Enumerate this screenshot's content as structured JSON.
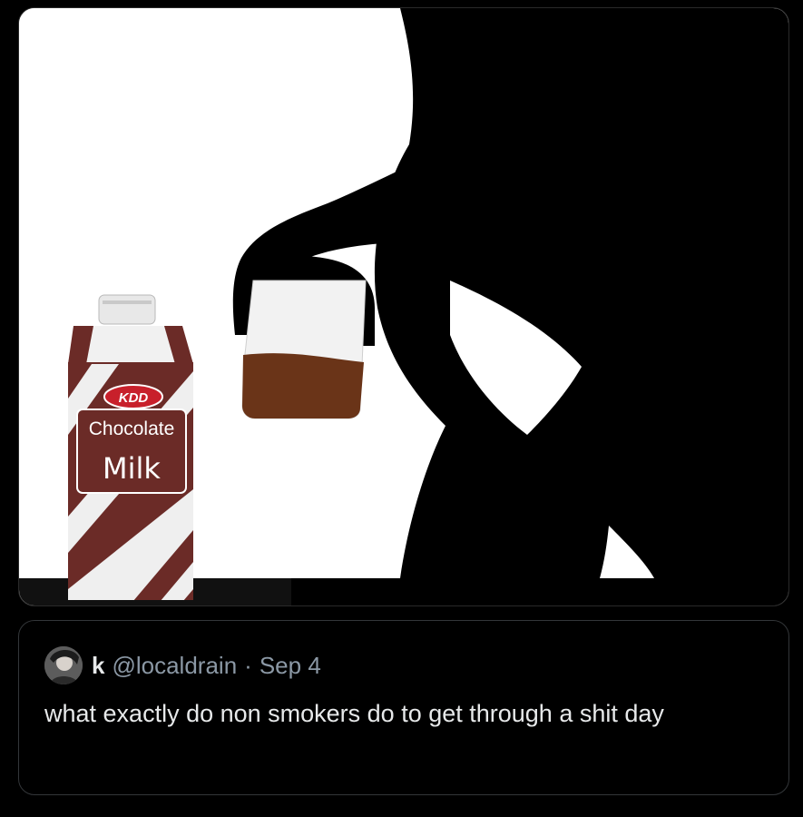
{
  "media": {
    "carton": {
      "brand": "KDD",
      "flavor": "Chocolate",
      "product": "Milk"
    },
    "colors": {
      "background": "#ffffff",
      "silhouette": "#000000",
      "carton_brown": "#6b2b27",
      "drink": "#6a3418",
      "brand_red": "#c8202b"
    }
  },
  "quote": {
    "avatar_icon": "profile-avatar",
    "display_name": "k",
    "handle": "@localdrain",
    "separator": "·",
    "date": "Sep 4",
    "text": "what exactly do non smokers do to get through a shit day"
  },
  "theme": {
    "page_bg": "#000000",
    "text_primary": "#e7e9ea",
    "text_secondary": "#8b98a5",
    "border": "#333639"
  }
}
